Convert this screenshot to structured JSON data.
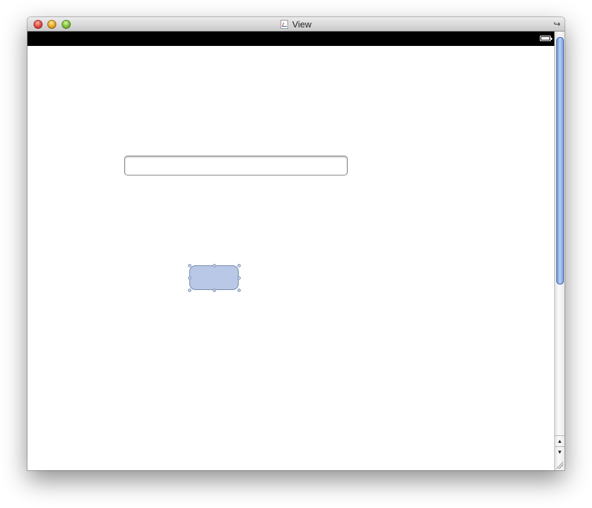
{
  "window": {
    "title": "View"
  },
  "icons": {
    "document": "document-icon",
    "collapse": "collapse-icon",
    "battery": "battery-icon",
    "scroll_up": "▲",
    "scroll_down": "▼",
    "resize": "resize-grip-icon"
  },
  "text_field": {
    "value": "",
    "placeholder": ""
  },
  "button": {
    "label": ""
  },
  "colors": {
    "status_bar": "#000000",
    "selection_fill": "#b8c8e6",
    "scroll_thumb": "#6f98dc"
  },
  "scroll": {
    "thumb_fraction": 0.58
  }
}
